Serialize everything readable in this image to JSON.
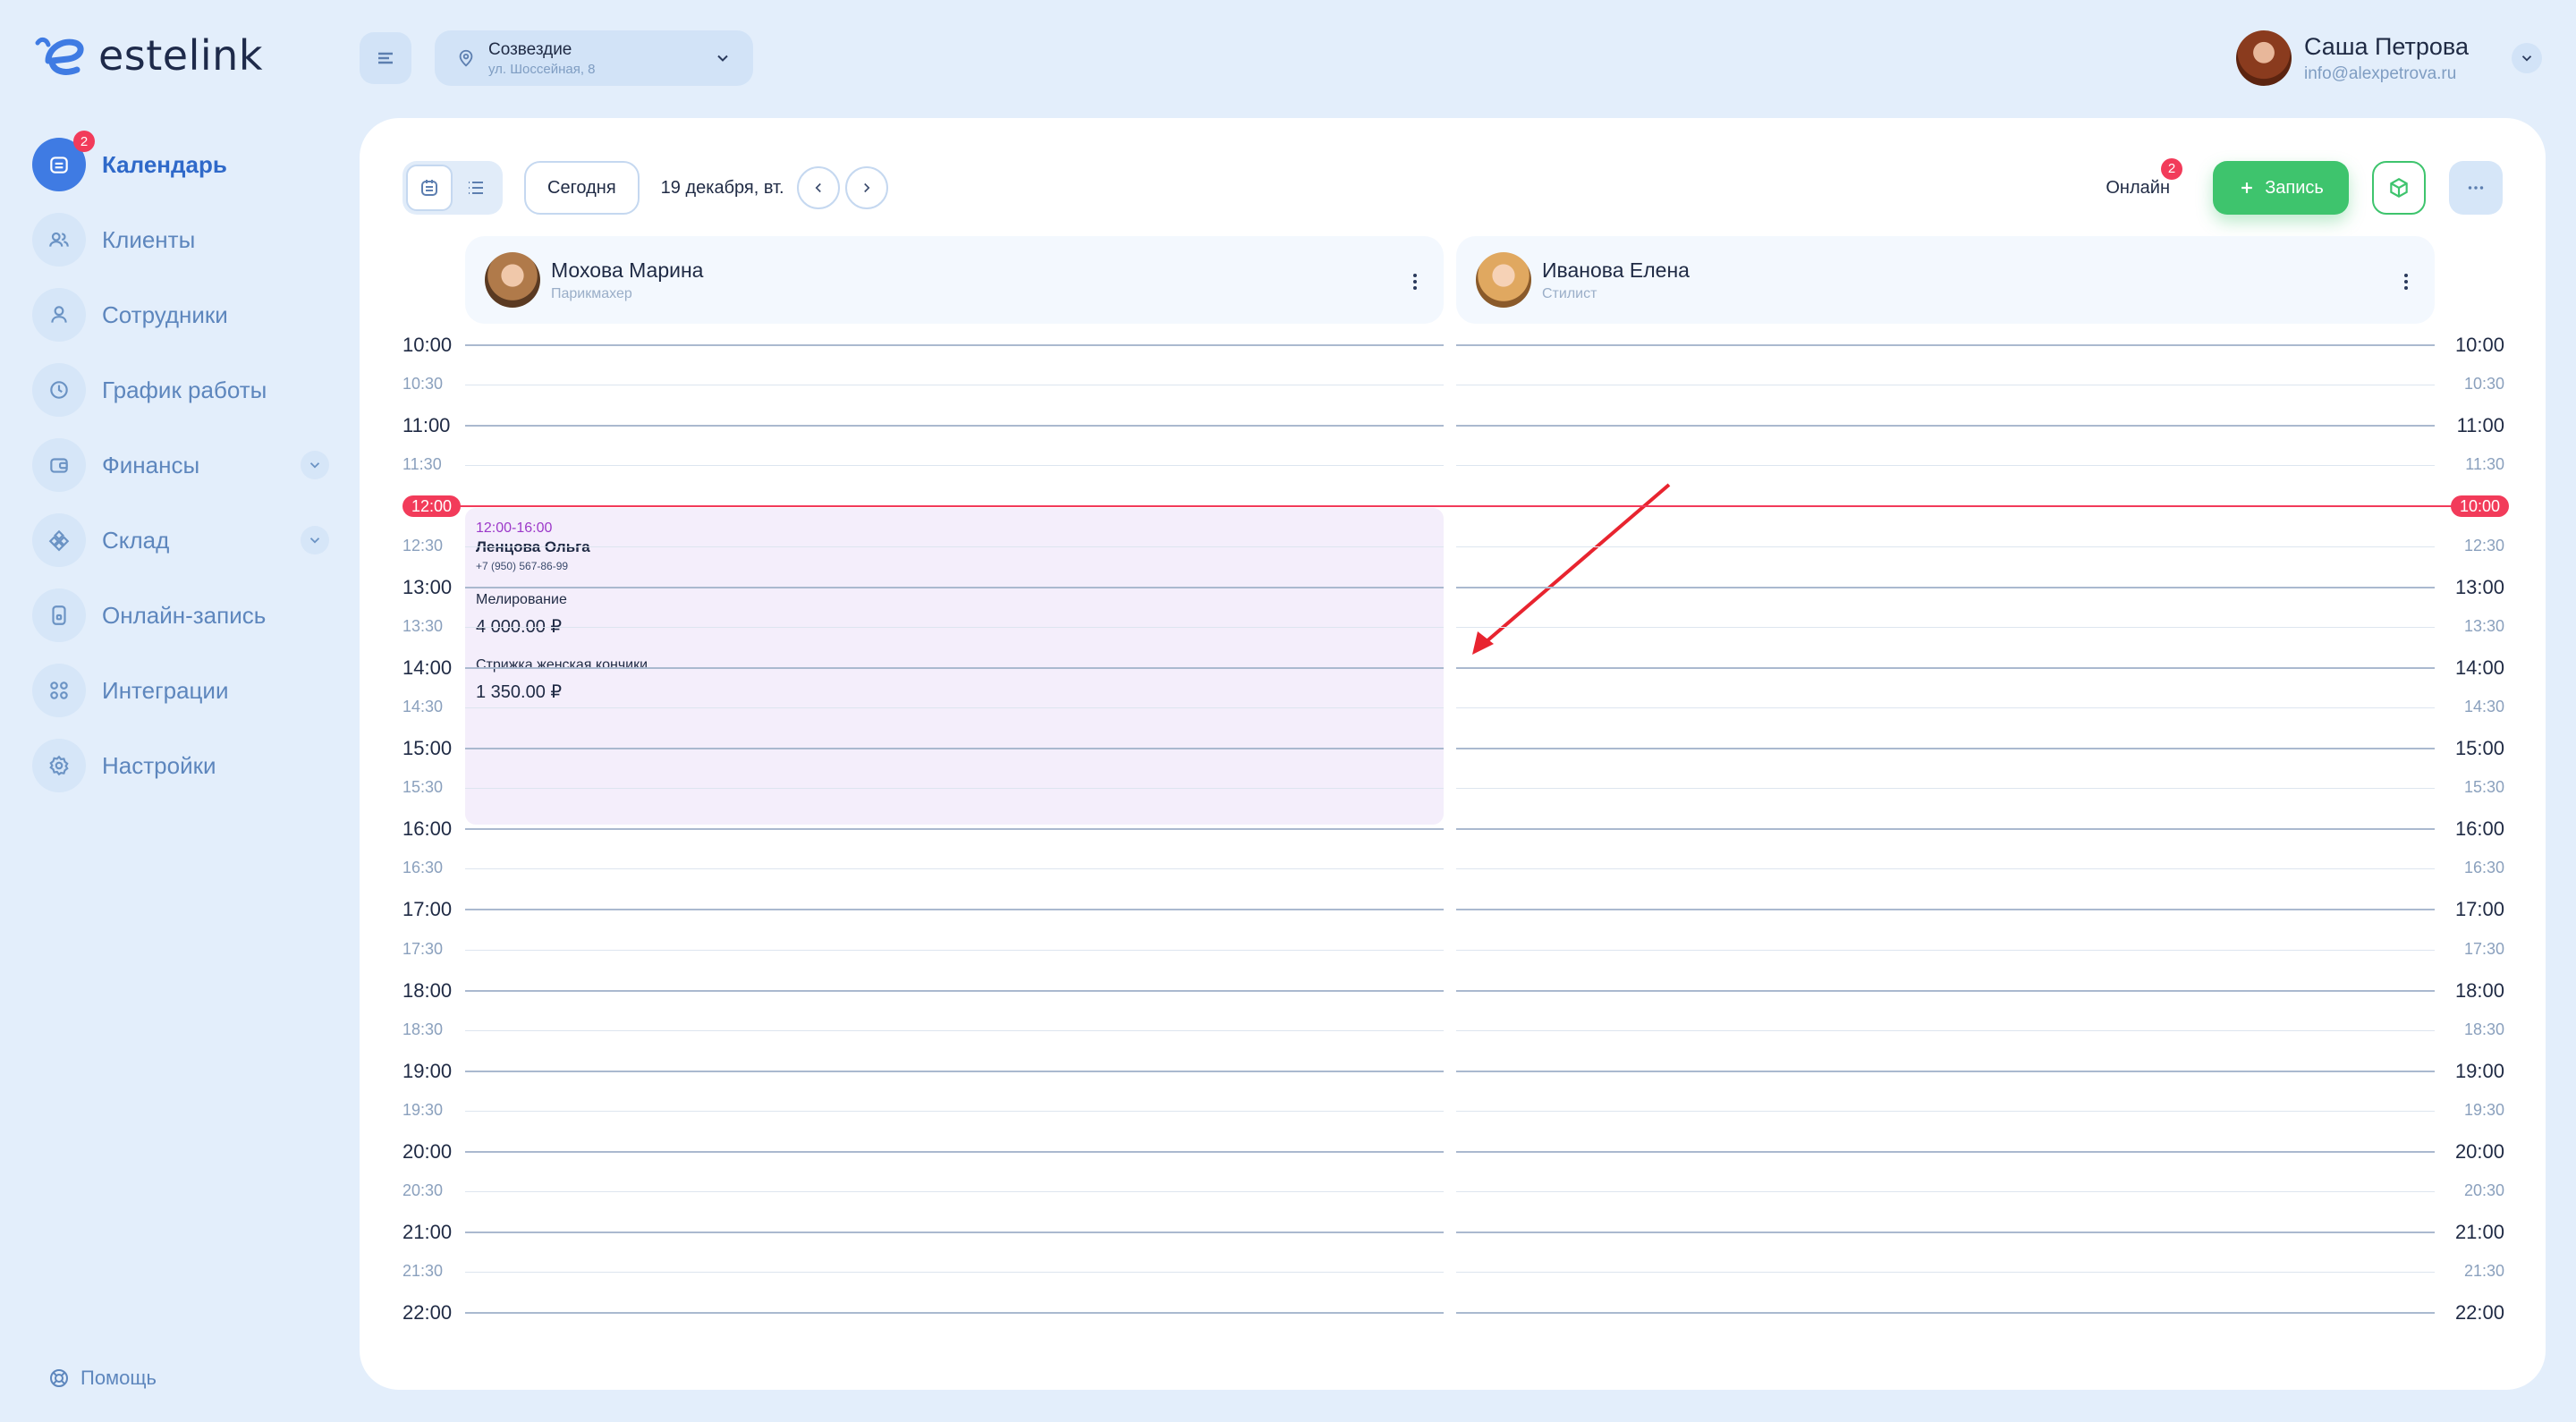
{
  "app": {
    "brand": "estelink"
  },
  "sidebar": {
    "items": [
      {
        "label": "Календарь",
        "icon": "calendar-icon",
        "badge": "2",
        "active": true
      },
      {
        "label": "Клиенты",
        "icon": "clients-icon"
      },
      {
        "label": "Сотрудники",
        "icon": "user-icon"
      },
      {
        "label": "График работы",
        "icon": "clock-icon"
      },
      {
        "label": "Финансы",
        "icon": "wallet-icon",
        "expandable": true
      },
      {
        "label": "Склад",
        "icon": "warehouse-icon",
        "expandable": true
      },
      {
        "label": "Онлайн-запись",
        "icon": "phone-icon"
      },
      {
        "label": "Интеграции",
        "icon": "grid-icon"
      },
      {
        "label": "Настройки",
        "icon": "gear-icon"
      }
    ],
    "help": "Помощь"
  },
  "header": {
    "location": {
      "name": "Созвездие",
      "address": "ул. Шоссейная, 8"
    },
    "user": {
      "name": "Саша Петрова",
      "email": "info@alexpetrova.ru"
    }
  },
  "toolbar": {
    "today": "Сегодня",
    "date": "19 декабря, вт.",
    "online": "Онлайн",
    "online_badge": "2",
    "book": "Запись"
  },
  "staff": [
    {
      "name": "Мохова Марина",
      "role": "Парикмахер"
    },
    {
      "name": "Иванова Елена",
      "role": "Стилист"
    }
  ],
  "times": [
    "10:00",
    "10:30",
    "11:00",
    "11:30",
    "12:00",
    "12:30",
    "13:00",
    "13:30",
    "14:00",
    "14:30",
    "15:00",
    "15:30",
    "16:00",
    "16:30",
    "17:00",
    "17:30",
    "18:00",
    "18:30",
    "19:00",
    "19:30",
    "20:00",
    "20:30",
    "21:00",
    "21:30",
    "22:00"
  ],
  "now": {
    "left": "12:00",
    "right": "10:00"
  },
  "appointment": {
    "time": "12:00-16:00",
    "client": "Ленцова Ольга",
    "phone": "+7 (950) 567-86-99",
    "services": [
      {
        "name": "Мелирование",
        "price": "4 000.00 ₽"
      },
      {
        "name": "Стрижка женская кончики",
        "price": "1 350.00 ₽"
      }
    ]
  },
  "colors": {
    "accent": "#3f7be3",
    "green": "#3ec46d",
    "now": "#f23b5a",
    "appointment_bg": "#f4eefb"
  }
}
